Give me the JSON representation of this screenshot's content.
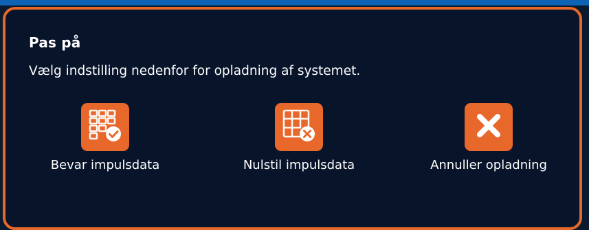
{
  "dialog": {
    "title": "Pas på",
    "message": "Vælg indstilling nedenfor for opladning af systemet.",
    "options": [
      {
        "label": "Bevar impulsdata",
        "icon": "grid-check-icon"
      },
      {
        "label": "Nulstil impulsdata",
        "icon": "grid-x-icon"
      },
      {
        "label": "Annuller opladning",
        "icon": "close-icon"
      }
    ]
  },
  "colors": {
    "accent": "#e8672a",
    "background": "#07142a",
    "text": "#ffffff",
    "top_strip": "#0f63b4"
  }
}
